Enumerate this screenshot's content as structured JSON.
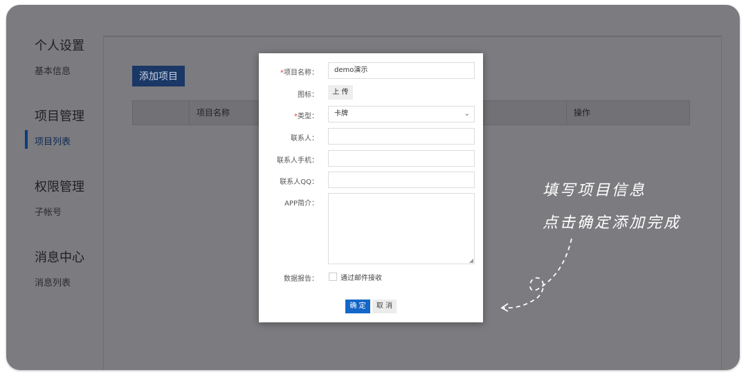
{
  "sidebar": {
    "groups": [
      {
        "title": "个人设置",
        "items": [
          "基本信息"
        ]
      },
      {
        "title": "项目管理",
        "items": [
          "项目列表"
        ]
      },
      {
        "title": "权限管理",
        "items": [
          "子帐号"
        ]
      },
      {
        "title": "消息中心",
        "items": [
          "消息列表"
        ]
      }
    ]
  },
  "main": {
    "add_button": "添加项目",
    "columns": [
      "项目名称",
      "操作"
    ]
  },
  "modal": {
    "name_label": "项目名称：",
    "name_value": "demo演示",
    "icon_label": "图标：",
    "upload_label": "上 传",
    "type_label": "类型：",
    "type_value": "卡牌",
    "contact_label": "联系人：",
    "phone_label": "联系人手机：",
    "qq_label": "联系人QQ：",
    "intro_label": "APP简介：",
    "report_label": "数据报告：",
    "report_option": "通过邮件接收",
    "ok_label": "确 定",
    "cancel_label": "取 消",
    "required_mark": "*"
  },
  "annotation": {
    "line1": "填写项目信息",
    "line2": "点击确定添加完成"
  }
}
